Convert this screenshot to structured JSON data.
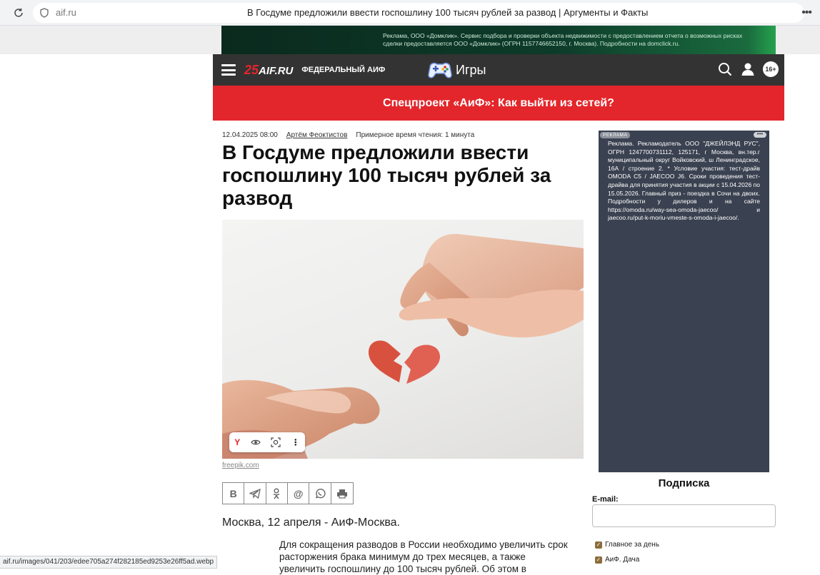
{
  "browser": {
    "url": "aif.ru",
    "tab_title": "В Госдуме предложили ввести госпошлину 100 тысяч рублей за развод | Аргументы и Факты",
    "status_url": "aif.ru/images/041/203/edee705a274f282185ed9253e26ff5ad.webp"
  },
  "top_ad": {
    "text": "Реклама, ООО «Домклик». Сервис подбора и проверки объекта недвижимости с предоставлением отчета о возможных рисках сделки предоставляется ООО «Домклик» (ОГРН 1157746652150, г. Москва). Подробности на domclick.ru."
  },
  "header": {
    "logo_num": "25",
    "logo_name": "AIF.RU",
    "section": "ФЕДЕРАЛЬНЫЙ АИФ",
    "games_label": "Игры",
    "age_rating": "16+"
  },
  "promo": {
    "text": "Спецпроект «АиФ»: Как выйти из сетей?"
  },
  "article": {
    "date": "12.04.2025 08:00",
    "author": "Артём Феоктистов",
    "reading_time": "Примерное время чтения: 1 минута",
    "headline": "В Госдуме предложили ввести госпошлину 100 тысяч рублей за развод",
    "photo_credit": "freepik.com",
    "lead": "Москва, 12 апреля - АиФ-Москва.",
    "body": "Для сокращения разводов в России необходимо увеличить срок расторжения брака минимум до трех месяцев, а также увеличить госпошлину до 100 тысяч рублей. Об этом в"
  },
  "share_buttons": [
    "vk",
    "telegram",
    "odnoklassniki",
    "mail",
    "whatsapp",
    "print"
  ],
  "sidebar": {
    "ad_badge": "РЕКЛАМА",
    "ad_text": "Реклама. Рекламодатель ООО \"ДЖЕЙЛЭНД РУС\", ОГРН 1247700731112, 125171, г Москва, вн.тер.г муниципальный округ Войковский, ш Ленинградское, 16А / строение 2. * Условие участия: тест-драйв OMODA C5 / JAECOO J6. Сроки проведения тест-драйва для принятия участия в акции с 15.04.2026 по 15.05.2026. Главный приз - поездка в Сочи на двоих. Подробности у дилеров и на сайте https://omoda.ru/way-sea-omoda-jaecoo/ и jaecoo.ru/put-k-moriu-vmeste-s-omoda-i-jaecoo/.",
    "subscription_title": "Подписка",
    "email_label": "E-mail:",
    "email_value": "",
    "checkboxes": [
      {
        "label": "Главное за день",
        "checked": true
      },
      {
        "label": "АиФ. Дача",
        "checked": true
      }
    ]
  },
  "colors": {
    "brand_red": "#e3262b",
    "header_dark": "#333333",
    "ad_dark": "#3a4150"
  }
}
